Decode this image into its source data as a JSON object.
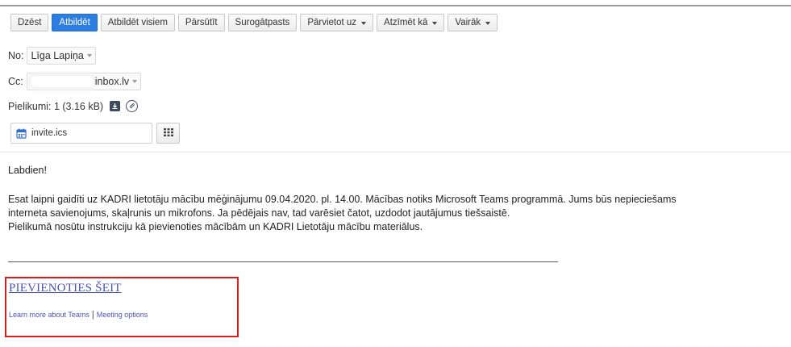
{
  "toolbar": {
    "buttons": [
      {
        "label": "Dzēst"
      },
      {
        "label": "Atbildēt"
      },
      {
        "label": "Atbildēt visiem"
      },
      {
        "label": "Pārsūtīt"
      },
      {
        "label": "Surogātpasts"
      },
      {
        "label": "Pārvietot uz"
      },
      {
        "label": "Atzīmēt kā"
      },
      {
        "label": "Vairāk"
      }
    ]
  },
  "header": {
    "from_label": "No:",
    "from_value": "Līga Lapiņa",
    "cc_label": "Cc:",
    "cc_value": "inbox.lv",
    "attachments_label": "Pielikumi: 1 (3.16 kB)"
  },
  "attachment": {
    "filename": "invite.ics"
  },
  "message": {
    "greeting": "Labdien!",
    "line1": "Esat laipni gaidīti uz KADRI lietotāju mācību mēģinājumu 09.04.2020. pl. 14.00. Mācības notiks Microsoft Teams programmā. Jums būs nepieciešams",
    "line2": "interneta savienojums, skaļrunis un mikrofons. Ja pēdējais nav, tad varēsiet čatot, uzdodot jautājumus tiešsaistē.",
    "line3": "Pielikumā nosūtu instrukciju kā pievienoties mācībām un KADRI Lietotāju mācību materiālus."
  },
  "teams": {
    "join_link": "PIEVIENOTIES ŠEIT",
    "learn_more": "Learn more about Teams",
    "separator": "|",
    "meeting_options": "Meeting options"
  },
  "colors": {
    "primary_button": "#2d7ee2",
    "link": "#4b53bc",
    "highlight_border": "#e21b1b"
  }
}
